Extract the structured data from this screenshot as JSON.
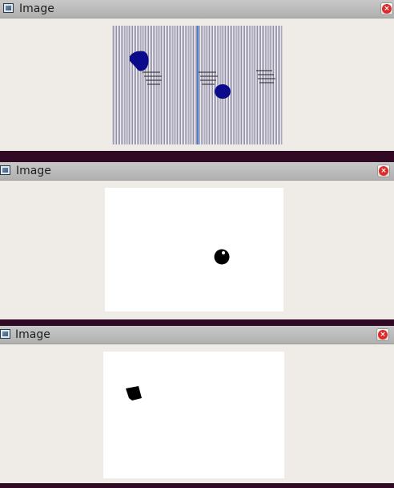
{
  "windows": [
    {
      "title": "Image",
      "icon": "image-window-icon",
      "close_icon": "close-icon",
      "close_label": "×",
      "content": "striped-color-frame"
    },
    {
      "title": "Image",
      "icon": "image-window-icon",
      "close_icon": "close-icon",
      "close_label": "×",
      "content": "binary-mask-ball"
    },
    {
      "title": "Image",
      "icon": "image-window-icon",
      "close_icon": "close-icon",
      "close_label": "×",
      "content": "binary-mask-block"
    }
  ],
  "colors": {
    "desktop": "#300a24",
    "window_bg": "#efebe7",
    "titlebar": "#b8b8b8",
    "blob": "#0a0a8a",
    "mask_fg": "#000000",
    "mask_bg": "#ffffff",
    "close": "#df2a2a"
  }
}
